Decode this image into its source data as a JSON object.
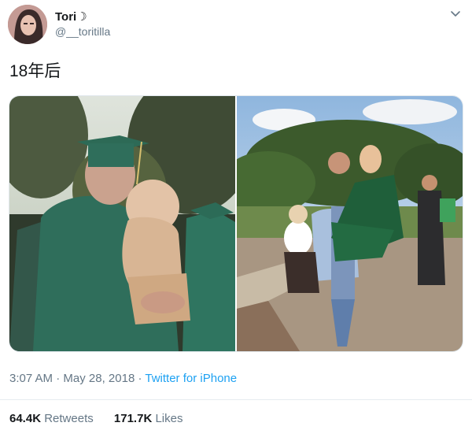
{
  "author": {
    "display_name": "Tori☽",
    "handle": "@__toritilla",
    "avatar_icon": "profile-photo"
  },
  "tweet": {
    "text": "18年后"
  },
  "media": {
    "left_photo": "vintage-graduation-photo",
    "right_photo": "recent-graduation-photo"
  },
  "meta": {
    "time": "3:07 AM",
    "separator": "·",
    "date": "May 28, 2018",
    "source": "Twitter for iPhone"
  },
  "stats": {
    "retweets_count": "64.4K",
    "retweets_label": "Retweets",
    "likes_count": "171.7K",
    "likes_label": "Likes"
  },
  "colors": {
    "link": "#1da1f2",
    "secondary_text": "#657786",
    "primary_text": "#14171a"
  }
}
